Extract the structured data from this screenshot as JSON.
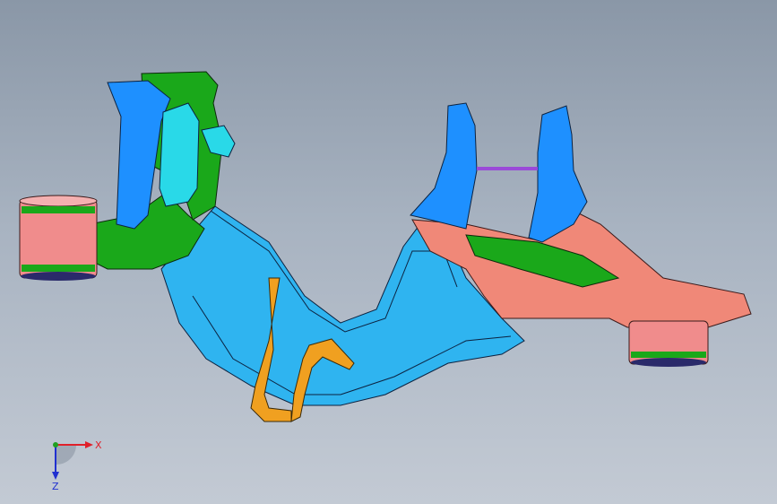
{
  "viewport": {
    "background_top": "#8a97a7",
    "background_bottom": "#c3cad4"
  },
  "model": {
    "parts": [
      {
        "name": "left-bushing",
        "color": "#f08c8c"
      },
      {
        "name": "green-arm-bracket",
        "color": "#1aa81a"
      },
      {
        "name": "blue-tower-left",
        "color": "#1e90ff"
      },
      {
        "name": "cyan-plate",
        "color": "#29d9e8"
      },
      {
        "name": "main-cross-member",
        "color": "#2fb4f0"
      },
      {
        "name": "salmon-rear-bracket",
        "color": "#f08878"
      },
      {
        "name": "right-bushing",
        "color": "#f08c8c"
      },
      {
        "name": "orange-links",
        "color": "#f0a020"
      },
      {
        "name": "purple-rod",
        "color": "#9a4ad8"
      }
    ]
  },
  "triad": {
    "x_label": "X",
    "z_label": "Z",
    "icons": [
      "axis-triad-icon"
    ]
  }
}
